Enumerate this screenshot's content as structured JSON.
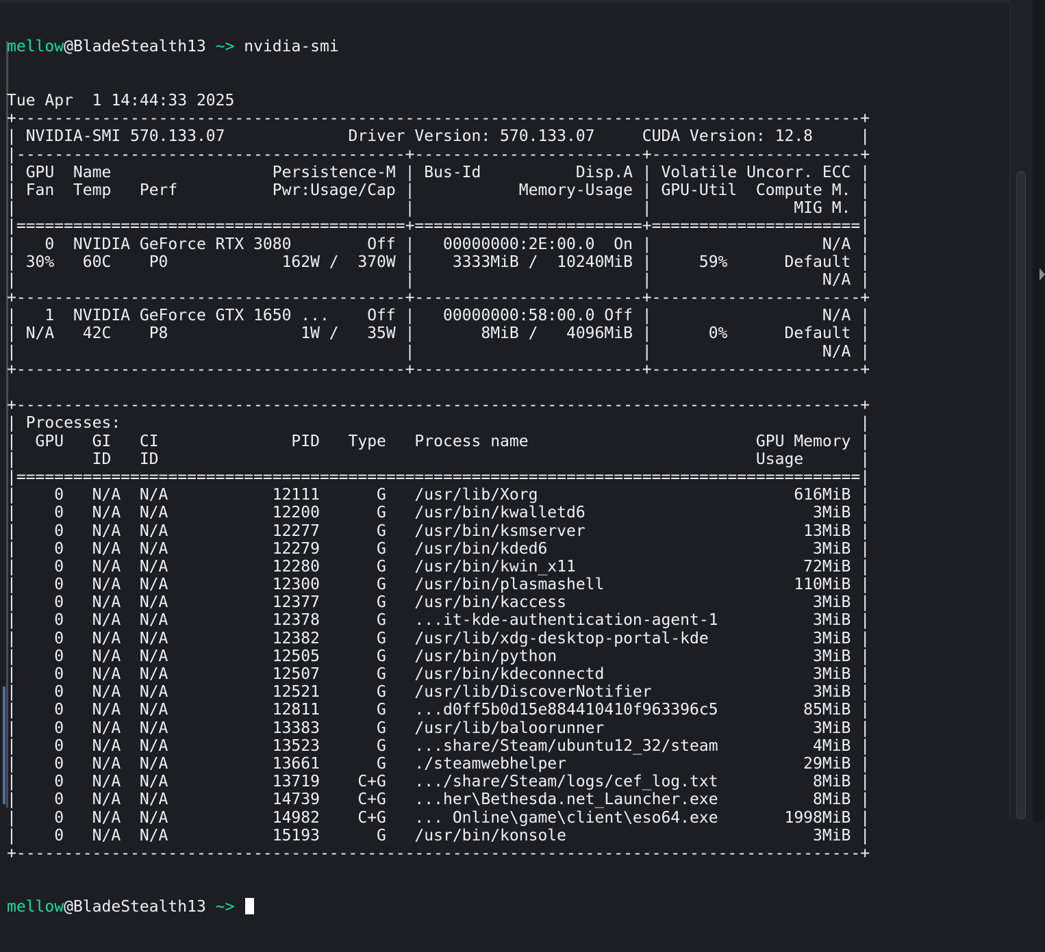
{
  "prompt": {
    "user": "mellow",
    "at": "@",
    "host": "BladeStealth13",
    "dir": " ~>",
    "command": " nvidia-smi"
  },
  "lines": [
    "Tue Apr  1 14:44:33 2025",
    "+-----------------------------------------------------------------------------------------+",
    "| NVIDIA-SMI 570.133.07             Driver Version: 570.133.07     CUDA Version: 12.8     |",
    "|-----------------------------------------+------------------------+----------------------+",
    "| GPU  Name                 Persistence-M | Bus-Id          Disp.A | Volatile Uncorr. ECC |",
    "| Fan  Temp   Perf          Pwr:Usage/Cap |           Memory-Usage | GPU-Util  Compute M. |",
    "|                                         |                        |               MIG M. |",
    "|=========================================+========================+======================|",
    "|   0  NVIDIA GeForce RTX 3080        Off |   00000000:2E:00.0  On |                  N/A |",
    "| 30%   60C    P0            162W /  370W |    3333MiB /  10240MiB |     59%      Default |",
    "|                                         |                        |                  N/A |",
    "+-----------------------------------------+------------------------+----------------------+",
    "|   1  NVIDIA GeForce GTX 1650 ...    Off |   00000000:58:00.0 Off |                  N/A |",
    "| N/A   42C    P8              1W /   35W |       8MiB /   4096MiB |      0%      Default |",
    "|                                         |                        |                  N/A |",
    "+-----------------------------------------+------------------------+----------------------+",
    "",
    "+-----------------------------------------------------------------------------------------+",
    "| Processes:                                                                              |",
    "|  GPU   GI   CI              PID   Type   Process name                        GPU Memory |",
    "|        ID   ID                                                               Usage      |",
    "|=========================================================================================|",
    "|    0   N/A  N/A           12111      G   /usr/lib/Xorg                           616MiB |",
    "|    0   N/A  N/A           12200      G   /usr/bin/kwalletd6                        3MiB |",
    "|    0   N/A  N/A           12277      G   /usr/bin/ksmserver                       13MiB |",
    "|    0   N/A  N/A           12279      G   /usr/bin/kded6                            3MiB |",
    "|    0   N/A  N/A           12280      G   /usr/bin/kwin_x11                        72MiB |",
    "|    0   N/A  N/A           12300      G   /usr/bin/plasmashell                    110MiB |",
    "|    0   N/A  N/A           12377      G   /usr/bin/kaccess                          3MiB |",
    "|    0   N/A  N/A           12378      G   ...it-kde-authentication-agent-1          3MiB |",
    "|    0   N/A  N/A           12382      G   /usr/lib/xdg-desktop-portal-kde           3MiB |",
    "|    0   N/A  N/A           12505      G   /usr/bin/python                           3MiB |",
    "|    0   N/A  N/A           12507      G   /usr/bin/kdeconnectd                      3MiB |",
    "|    0   N/A  N/A           12521      G   /usr/lib/DiscoverNotifier                 3MiB |",
    "|    0   N/A  N/A           12811      G   ...d0ff5b0d15e884410410f963396c5         85MiB |",
    "|    0   N/A  N/A           13383      G   /usr/lib/baloorunner                      3MiB |",
    "|    0   N/A  N/A           13523      G   ...share/Steam/ubuntu12_32/steam          4MiB |",
    "|    0   N/A  N/A           13661      G   ./steamwebhelper                         29MiB |",
    "|    0   N/A  N/A           13719    C+G   .../share/Steam/logs/cef_log.txt          8MiB |",
    "|    0   N/A  N/A           14739    C+G   ...her\\Bethesda.net_Launcher.exe          8MiB |",
    "|    0   N/A  N/A           14982    C+G   ... Online\\game\\client\\eso64.exe       1998MiB |",
    "|    0   N/A  N/A           15193      G   /usr/bin/konsole                          3MiB |",
    "+-----------------------------------------------------------------------------------------+"
  ]
}
